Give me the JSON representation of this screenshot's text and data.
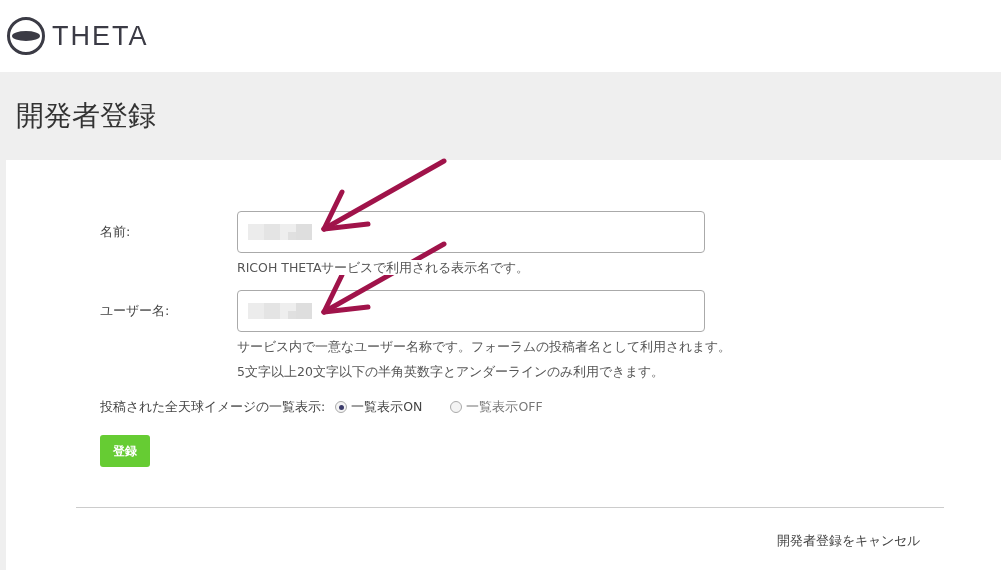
{
  "logo": {
    "text": "THETA"
  },
  "page_title": "開発者登録",
  "fields": [
    {
      "label": "名前:",
      "value_redacted": true,
      "hints": [
        "RICOH THETAサービスで利用される表示名です。"
      ]
    },
    {
      "label": "ユーザー名:",
      "value_redacted": true,
      "hints": [
        "サービス内で一意なユーザー名称です。フォーラムの投稿者名として利用されます。",
        "5文字以上20文字以下の半角英数字とアンダーラインのみ利用できます。"
      ]
    }
  ],
  "gallery_setting": {
    "label": "投稿された全天球イメージの一覧表示:",
    "options": [
      {
        "label": "一覧表示ON",
        "selected": true
      },
      {
        "label": "一覧表示OFF",
        "selected": false
      }
    ]
  },
  "submit_button": "登録",
  "cancel_link": "開発者登録をキャンセル",
  "annotations": [
    {
      "kind": "arrow"
    },
    {
      "kind": "arrow"
    }
  ]
}
